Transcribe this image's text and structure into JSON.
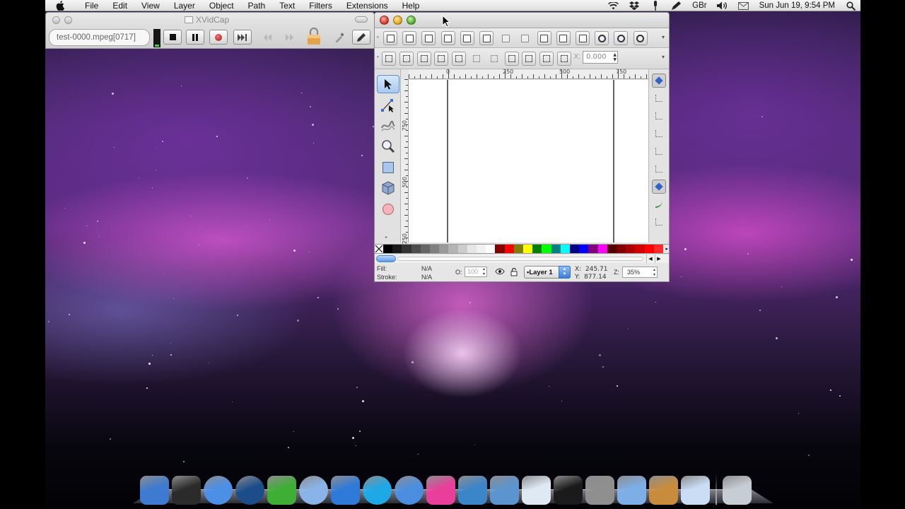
{
  "menubar": {
    "apple_icon": "apple-icon",
    "items": [
      "File",
      "Edit",
      "View",
      "Layer",
      "Object",
      "Path",
      "Text",
      "Filters",
      "Extensions",
      "Help"
    ],
    "status": {
      "keyboard_layout": "GBr",
      "clock": "Sun Jun 19,  9:54 PM",
      "icons": [
        "wifi-icon",
        "dropbox-icon",
        "microphone-icon",
        "pen-icon",
        "volume-icon",
        "mail-icon",
        "spotlight-icon"
      ]
    }
  },
  "xvidcap": {
    "title": "XVidCap",
    "filename": "test-0000.mpeg[0717]",
    "controls": [
      "stop-icon",
      "pause-icon",
      "record-icon",
      "step-icon",
      "rewind-icon",
      "fast-forward-icon",
      "lock-icon",
      "eyedropper-icon",
      "edit-icon"
    ]
  },
  "inkscape": {
    "commands_bar": [
      "new-icon",
      "open-icon",
      "save-icon",
      "print-icon",
      "import-icon",
      "export-icon",
      "undo-icon",
      "redo-icon",
      "copy-icon",
      "cut-icon",
      "paste-icon",
      "zoom-selection-icon",
      "zoom-drawing-icon",
      "zoom-page-icon"
    ],
    "controls_bar": {
      "x_label": "X:",
      "x_value": "0.000"
    },
    "tools": [
      "selector-tool-icon",
      "node-tool-icon",
      "tweak-tool-icon",
      "zoom-tool-icon",
      "rectangle-tool-icon",
      "box-3d-tool-icon",
      "ellipse-tool-icon"
    ],
    "ruler_top": [
      "0",
      "250",
      "500",
      "750"
    ],
    "ruler_left": [
      "750",
      "500",
      "250"
    ],
    "snap_controls": [
      "snap-toggle-icon",
      "snap-bbox-icon",
      "snap-bbox-edge-icon",
      "snap-bbox-corner-icon",
      "snap-bbox-midpoint-icon",
      "snap-center-icon",
      "snap-nodes-icon",
      "snap-path-icon",
      "snap-intersection-icon"
    ],
    "palette": [
      "#000000",
      "#1a1a1a",
      "#333333",
      "#4d4d4d",
      "#666666",
      "#808080",
      "#999999",
      "#b3b3b3",
      "#cccccc",
      "#e6e6e6",
      "#f2f2f2",
      "#ffffff",
      "#800000",
      "#ff0000",
      "#808000",
      "#ffff00",
      "#008000",
      "#00ff00",
      "#008080",
      "#00ffff",
      "#000080",
      "#0000ff",
      "#800080",
      "#ff00ff",
      "#550000",
      "#800000",
      "#aa0000",
      "#d40000",
      "#ff0000",
      "#ff2a2a"
    ],
    "status": {
      "fill_label": "Fill:",
      "fill_value": "N/A",
      "stroke_label": "Stroke:",
      "stroke_value": "N/A",
      "opacity_label": "O:",
      "opacity_value": "100",
      "layer": "•Layer 1",
      "x_label": "X:",
      "x_value": "245.71",
      "y_label": "Y:",
      "y_value": "877.14",
      "zoom_label": "Z:",
      "zoom_value": "35%"
    }
  },
  "dock": {
    "apps": [
      {
        "name": "anchor-app-icon",
        "color": "#3d7ad1"
      },
      {
        "name": "imac-icon",
        "color": "#2b2b2b"
      },
      {
        "name": "chrome-icon",
        "color": "#4c8fe6"
      },
      {
        "name": "globe-icon",
        "color": "#1c4d8a"
      },
      {
        "name": "adium-duck-icon",
        "color": "#3fae35"
      },
      {
        "name": "quicktime-icon",
        "color": "#8ab4e8"
      },
      {
        "name": "uberbar-icon",
        "color": "#2f7ad9"
      },
      {
        "name": "skype-icon",
        "color": "#1ea8e6"
      },
      {
        "name": "itunes-icon",
        "color": "#4b8ee0"
      },
      {
        "name": "flower-app-icon",
        "color": "#e93f9a"
      },
      {
        "name": "quill-icon",
        "color": "#3b85c9"
      },
      {
        "name": "screenshot-app-icon",
        "color": "#5b94cf"
      },
      {
        "name": "preview-icon",
        "color": "#dfe9f4"
      },
      {
        "name": "terminal-icon",
        "color": "#1a1a1a"
      },
      {
        "name": "system-preferences-icon",
        "color": "#8f8f8f"
      },
      {
        "name": "folder-icon",
        "color": "#7eaee6"
      },
      {
        "name": "package-app-icon",
        "color": "#c98c3c"
      },
      {
        "name": "window-app-icon",
        "color": "#c9ddf4"
      }
    ],
    "trash": {
      "name": "trash-icon",
      "color": "#c7cdd4"
    }
  }
}
